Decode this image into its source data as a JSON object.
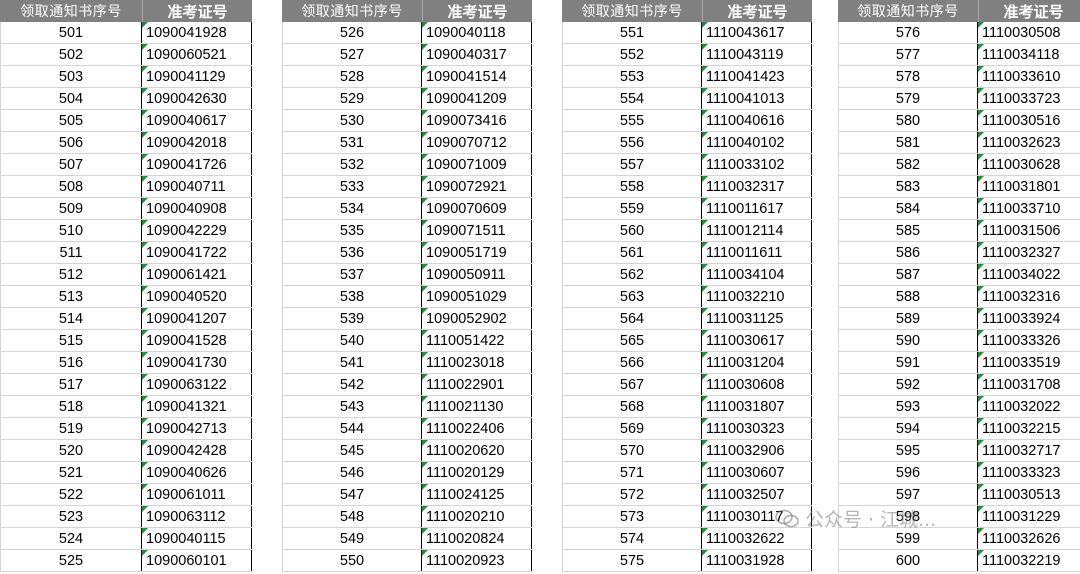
{
  "headers": {
    "seq": "领取通知书序号",
    "id": "准考证号"
  },
  "watermark": {
    "text": "公众号 · 江城..."
  },
  "tables": [
    {
      "rows": [
        [
          "501",
          "1090041928"
        ],
        [
          "502",
          "1090060521"
        ],
        [
          "503",
          "1090041129"
        ],
        [
          "504",
          "1090042630"
        ],
        [
          "505",
          "1090040617"
        ],
        [
          "506",
          "1090042018"
        ],
        [
          "507",
          "1090041726"
        ],
        [
          "508",
          "1090040711"
        ],
        [
          "509",
          "1090040908"
        ],
        [
          "510",
          "1090042229"
        ],
        [
          "511",
          "1090041722"
        ],
        [
          "512",
          "1090061421"
        ],
        [
          "513",
          "1090040520"
        ],
        [
          "514",
          "1090041207"
        ],
        [
          "515",
          "1090041528"
        ],
        [
          "516",
          "1090041730"
        ],
        [
          "517",
          "1090063122"
        ],
        [
          "518",
          "1090041321"
        ],
        [
          "519",
          "1090042713"
        ],
        [
          "520",
          "1090042428"
        ],
        [
          "521",
          "1090040626"
        ],
        [
          "522",
          "1090061011"
        ],
        [
          "523",
          "1090063112"
        ],
        [
          "524",
          "1090040115"
        ],
        [
          "525",
          "1090060101"
        ]
      ]
    },
    {
      "rows": [
        [
          "526",
          "1090040118"
        ],
        [
          "527",
          "1090040317"
        ],
        [
          "528",
          "1090041514"
        ],
        [
          "529",
          "1090041209"
        ],
        [
          "530",
          "1090073416"
        ],
        [
          "531",
          "1090070712"
        ],
        [
          "532",
          "1090071009"
        ],
        [
          "533",
          "1090072921"
        ],
        [
          "534",
          "1090070609"
        ],
        [
          "535",
          "1090071511"
        ],
        [
          "536",
          "1090051719"
        ],
        [
          "537",
          "1090050911"
        ],
        [
          "538",
          "1090051029"
        ],
        [
          "539",
          "1090052902"
        ],
        [
          "540",
          "1110051422"
        ],
        [
          "541",
          "1110023018"
        ],
        [
          "542",
          "1110022901"
        ],
        [
          "543",
          "1110021130"
        ],
        [
          "544",
          "1110022406"
        ],
        [
          "545",
          "1110020620"
        ],
        [
          "546",
          "1110020129"
        ],
        [
          "547",
          "1110024125"
        ],
        [
          "548",
          "1110020210"
        ],
        [
          "549",
          "1110020824"
        ],
        [
          "550",
          "1110020923"
        ]
      ]
    },
    {
      "rows": [
        [
          "551",
          "1110043617"
        ],
        [
          "552",
          "1110043119"
        ],
        [
          "553",
          "1110041423"
        ],
        [
          "554",
          "1110041013"
        ],
        [
          "555",
          "1110040616"
        ],
        [
          "556",
          "1110040102"
        ],
        [
          "557",
          "1110033102"
        ],
        [
          "558",
          "1110032317"
        ],
        [
          "559",
          "1110011617"
        ],
        [
          "560",
          "1110012114"
        ],
        [
          "561",
          "1110011611"
        ],
        [
          "562",
          "1110034104"
        ],
        [
          "563",
          "1110032210"
        ],
        [
          "564",
          "1110031125"
        ],
        [
          "565",
          "1110030617"
        ],
        [
          "566",
          "1110031204"
        ],
        [
          "567",
          "1110030608"
        ],
        [
          "568",
          "1110031807"
        ],
        [
          "569",
          "1110030323"
        ],
        [
          "570",
          "1110032906"
        ],
        [
          "571",
          "1110030607"
        ],
        [
          "572",
          "1110032507"
        ],
        [
          "573",
          "1110030117"
        ],
        [
          "574",
          "1110032622"
        ],
        [
          "575",
          "1110031928"
        ]
      ]
    },
    {
      "rows": [
        [
          "576",
          "1110030508"
        ],
        [
          "577",
          "1110034118"
        ],
        [
          "578",
          "1110033610"
        ],
        [
          "579",
          "1110033723"
        ],
        [
          "580",
          "1110030516"
        ],
        [
          "581",
          "1110032623"
        ],
        [
          "582",
          "1110030628"
        ],
        [
          "583",
          "1110031801"
        ],
        [
          "584",
          "1110033710"
        ],
        [
          "585",
          "1110031506"
        ],
        [
          "586",
          "1110032327"
        ],
        [
          "587",
          "1110034022"
        ],
        [
          "588",
          "1110032316"
        ],
        [
          "589",
          "1110033924"
        ],
        [
          "590",
          "1110033326"
        ],
        [
          "591",
          "1110033519"
        ],
        [
          "592",
          "1110031708"
        ],
        [
          "593",
          "1110032022"
        ],
        [
          "594",
          "1110032215"
        ],
        [
          "595",
          "1110032717"
        ],
        [
          "596",
          "1110033323"
        ],
        [
          "597",
          "1110030513"
        ],
        [
          "598",
          "1110031229"
        ],
        [
          "599",
          "1110032626"
        ],
        [
          "600",
          "1110032219"
        ]
      ]
    }
  ]
}
